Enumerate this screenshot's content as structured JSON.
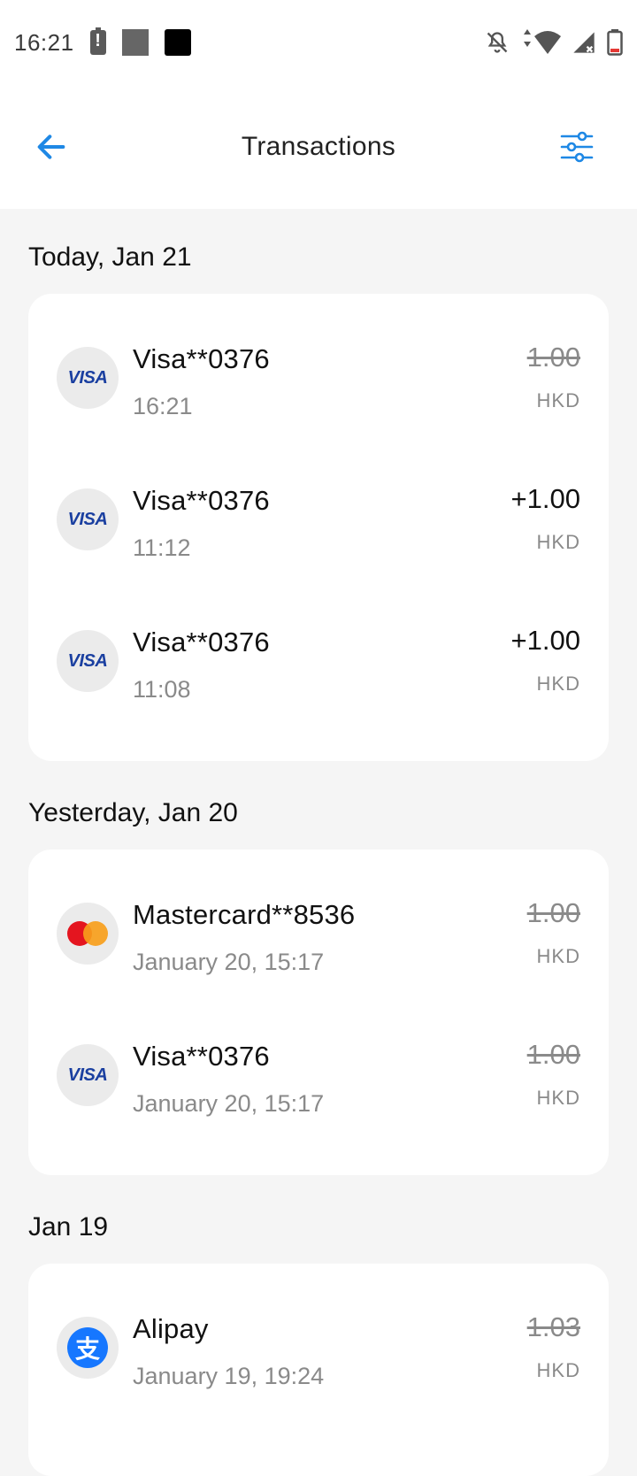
{
  "status_bar": {
    "time": "16:21",
    "icons_left": [
      "battery-alert-icon",
      "gray-square-icon",
      "black-square-icon"
    ],
    "icons_right": [
      "bell-off-icon",
      "wifi-icon",
      "signal-icon",
      "battery-icon"
    ]
  },
  "app_bar": {
    "title": "Transactions",
    "back_icon": "arrow-left-icon",
    "filter_icon": "sliders-icon",
    "accent_color": "#1e88e5"
  },
  "sections": [
    {
      "title": "Today, Jan 21",
      "transactions": [
        {
          "brand": "visa",
          "name": "Visa**0376",
          "time": "16:21",
          "amount": "1.00",
          "currency": "HKD",
          "struck": true
        },
        {
          "brand": "visa",
          "name": "Visa**0376",
          "time": "11:12",
          "amount": "+1.00",
          "currency": "HKD",
          "struck": false
        },
        {
          "brand": "visa",
          "name": "Visa**0376",
          "time": "11:08",
          "amount": "+1.00",
          "currency": "HKD",
          "struck": false
        }
      ]
    },
    {
      "title": "Yesterday, Jan 20",
      "transactions": [
        {
          "brand": "mastercard",
          "name": "Mastercard**8536",
          "time": "January 20, 15:17",
          "amount": "1.00",
          "currency": "HKD",
          "struck": true
        },
        {
          "brand": "visa",
          "name": "Visa**0376",
          "time": "January 20, 15:17",
          "amount": "1.00",
          "currency": "HKD",
          "struck": true
        }
      ]
    },
    {
      "title": "Jan 19",
      "transactions": [
        {
          "brand": "alipay",
          "name": "Alipay",
          "time": "January 19, 19:24",
          "amount": "1.03",
          "currency": "HKD",
          "struck": true
        }
      ]
    }
  ],
  "brand_labels": {
    "visa": "VISA",
    "alipay": "支"
  }
}
